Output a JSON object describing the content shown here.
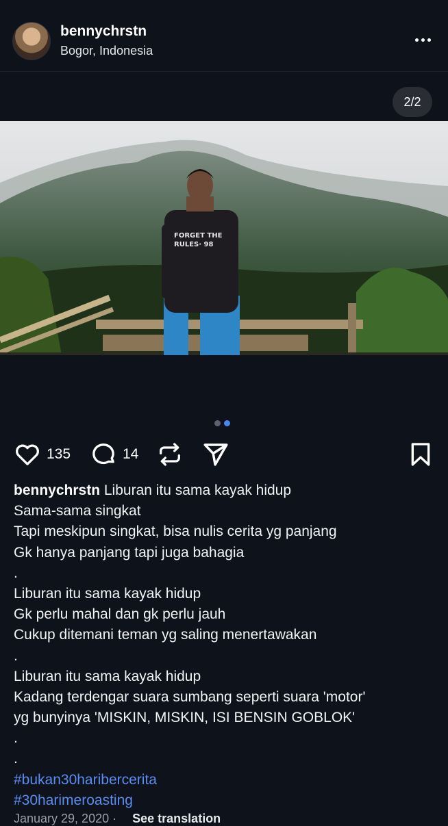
{
  "post": {
    "username": "bennychrstn",
    "location": "Bogor, Indonesia",
    "slide_counter": "2/2",
    "slide_total": 2,
    "slide_active": 2,
    "likes": "135",
    "comments": "14"
  },
  "caption": {
    "username": "bennychrstn",
    "first_line": "Liburan itu sama kayak hidup",
    "lines": [
      "Sama-sama singkat",
      "Tapi meskipun singkat, bisa nulis cerita yg panjang",
      "Gk hanya panjang tapi juga bahagia",
      ".",
      "Liburan itu sama kayak hidup",
      "Gk perlu mahal dan gk perlu jauh",
      "Cukup ditemani teman yg saling menertawakan",
      ".",
      "Liburan itu sama kayak hidup",
      "Kadang terdengar suara sumbang seperti suara 'motor'",
      "yg bunyinya 'MISKIN, MISKIN, ISI BENSIN GOBLOK'",
      ".",
      "."
    ],
    "hashtags": [
      "#bukan30haribercerita",
      "#30harimeroasting"
    ]
  },
  "footer": {
    "date": "January 29, 2020",
    "see_translation": "See translation"
  },
  "colors": {
    "background": "#0e121a",
    "hashtag": "#5c8cf0",
    "active_dot": "#4a86f0",
    "inactive_dot": "#5b6270"
  },
  "icons": {
    "like": "heart-icon",
    "comment": "comment-icon",
    "repost": "repost-icon",
    "share": "send-icon",
    "save": "bookmark-icon",
    "more": "more-dots-icon"
  }
}
